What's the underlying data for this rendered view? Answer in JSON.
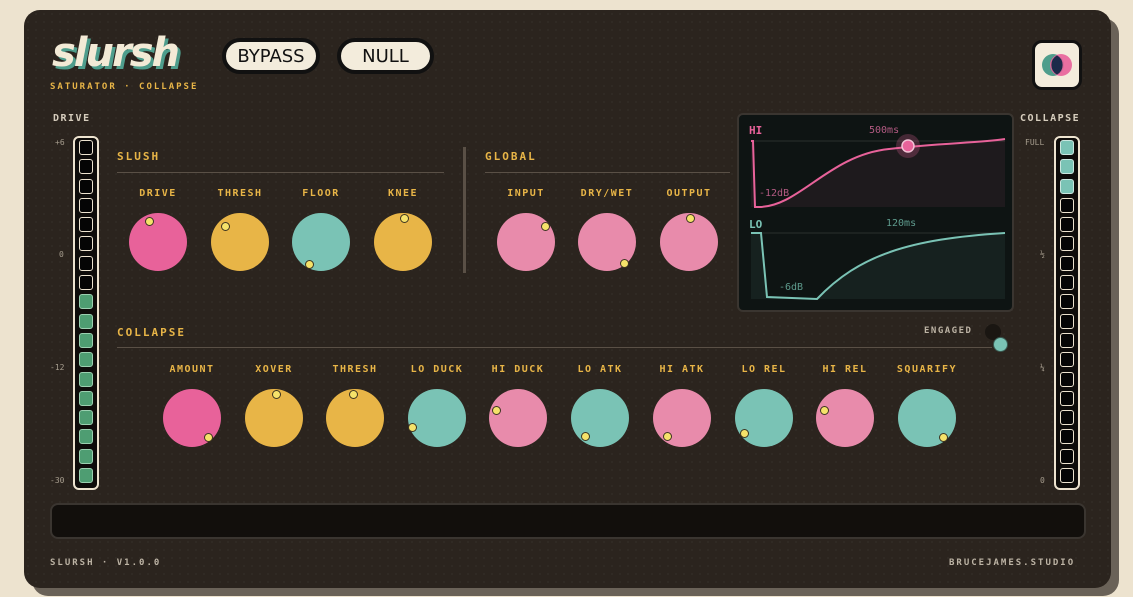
{
  "app": {
    "logo": "slursh",
    "subtitle": "SATURATOR · COLLAPSE",
    "bypass_label": "BYPASS",
    "null_label": "NULL"
  },
  "drive_meter": {
    "label": "DRIVE",
    "ticks": [
      "+6",
      "0",
      "-12",
      "-30"
    ],
    "lit_cells": 10,
    "total_cells": 18
  },
  "collapse_meter": {
    "label": "COLLAPSE",
    "ticks": [
      "FULL",
      "½",
      "¼",
      "0"
    ],
    "lit_cells": 3,
    "total_cells": 18
  },
  "slush": {
    "title": "SLUSH",
    "knobs": [
      {
        "label": "DRIVE",
        "color": "#e8629a"
      },
      {
        "label": "THRESH",
        "color": "#e8b547"
      },
      {
        "label": "FLOOR",
        "color": "#7ac3b5"
      },
      {
        "label": "KNEE",
        "color": "#e8b547"
      }
    ]
  },
  "global": {
    "title": "GLOBAL",
    "knobs": [
      {
        "label": "INPUT",
        "color": "#e88bab"
      },
      {
        "label": "DRY/WET",
        "color": "#e88bab"
      },
      {
        "label": "OUTPUT",
        "color": "#e88bab"
      }
    ]
  },
  "scope": {
    "hi_label": "HI",
    "hi_time": "500ms",
    "hi_gain": "-12dB",
    "lo_label": "LO",
    "lo_time": "120ms",
    "lo_gain": "-6dB"
  },
  "collapse": {
    "title": "COLLAPSE",
    "engaged_label": "ENGAGED",
    "knobs": [
      {
        "label": "AMOUNT",
        "color": "#e8629a"
      },
      {
        "label": "XOVER",
        "color": "#e8b547"
      },
      {
        "label": "THRESH",
        "color": "#e8b547"
      },
      {
        "label": "LO DUCK",
        "color": "#7ac3b5"
      },
      {
        "label": "HI DUCK",
        "color": "#e88bab"
      },
      {
        "label": "LO ATK",
        "color": "#7ac3b5"
      },
      {
        "label": "HI ATK",
        "color": "#e88bab"
      },
      {
        "label": "LO REL",
        "color": "#7ac3b5"
      },
      {
        "label": "HI REL",
        "color": "#e88bab"
      },
      {
        "label": "SQUARIFY",
        "color": "#7ac3b5"
      }
    ]
  },
  "footer": {
    "version": "SLURSH · V1.0.0",
    "studio": "BRUCEJAMES.STUDIO"
  }
}
